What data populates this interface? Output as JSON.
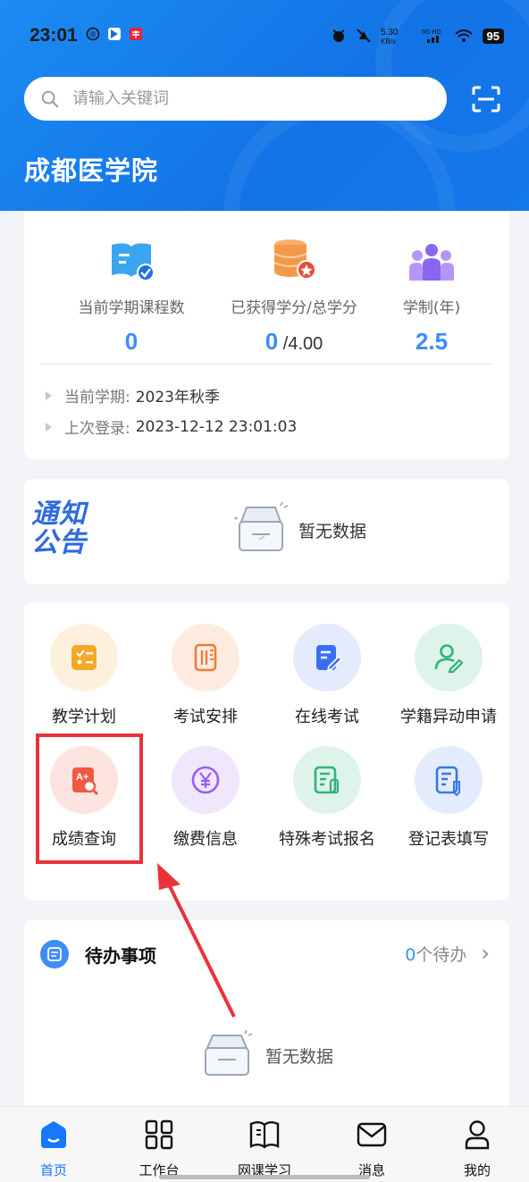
{
  "status_bar": {
    "time": "23:01",
    "speed": "5.30\nKB/s",
    "network": "5G HD",
    "battery": "95"
  },
  "search": {
    "placeholder": "请输入关键词"
  },
  "school_name": "成都医学院",
  "stats": [
    {
      "label": "当前学期课程数",
      "value": "0",
      "sub": ""
    },
    {
      "label": "已获得学分/总学分",
      "value": "0",
      "sub": " /4.00"
    },
    {
      "label": "学制(年)",
      "value": "2.5",
      "sub": ""
    }
  ],
  "info": {
    "term_key": "当前学期:",
    "term_value": "2023年秋季",
    "login_key": "上次登录:",
    "login_value": "2023-12-12 23:01:03"
  },
  "notice": {
    "logo_line1": "通知",
    "logo_line2": "公告",
    "empty_text": "暂无数据"
  },
  "grid": [
    {
      "label": "教学计划"
    },
    {
      "label": "考试安排"
    },
    {
      "label": "在线考试"
    },
    {
      "label": "学籍异动申请"
    },
    {
      "label": "成绩查询"
    },
    {
      "label": "缴费信息"
    },
    {
      "label": "特殊考试报名"
    },
    {
      "label": "登记表填写"
    }
  ],
  "todo": {
    "title": "待办事项",
    "count": "0",
    "count_suffix": "个待办",
    "chevron": "›",
    "empty_text": "暂无数据"
  },
  "tabs": [
    {
      "label": "首页"
    },
    {
      "label": "工作台"
    },
    {
      "label": "网课学习"
    },
    {
      "label": "消息"
    },
    {
      "label": "我的"
    }
  ],
  "colors": {
    "primary": "#1677ff",
    "highlight_box": "#e8333b",
    "arrow": "#e8333b"
  }
}
